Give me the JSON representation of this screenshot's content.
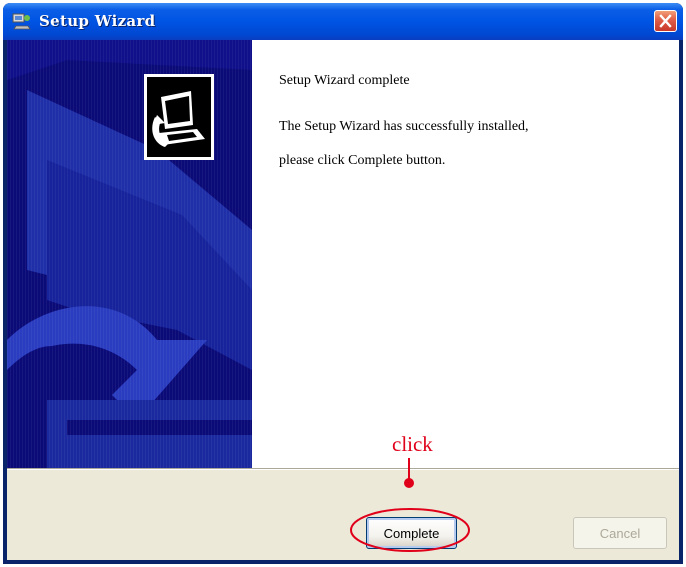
{
  "window": {
    "title": "Setup Wizard",
    "icons": {
      "title": "setup-wizard-icon",
      "close": "close-icon",
      "banner": "setup-computer-icon"
    }
  },
  "content": {
    "heading": "Setup Wizard complete",
    "message_line1": "The Setup Wizard has successfully installed,",
    "message_line2": "please click Complete button."
  },
  "buttons": {
    "complete": "Complete",
    "cancel": "Cancel"
  },
  "annotation": {
    "label": "click",
    "color": "#e0001a"
  },
  "colors": {
    "titlebar": "#0054e3",
    "banner": "#0a0a7a",
    "dialog_bg": "#ece9d8"
  }
}
